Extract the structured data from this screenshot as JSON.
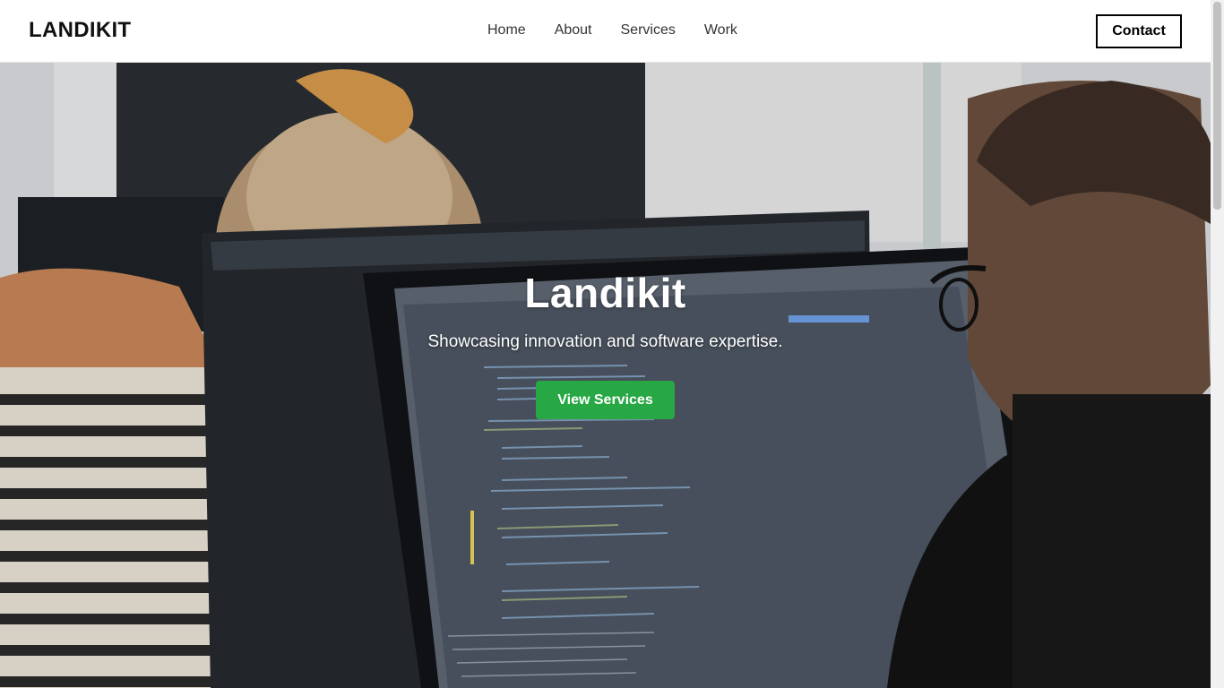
{
  "header": {
    "logo": "LANDIKIT",
    "nav": [
      "Home",
      "About",
      "Services",
      "Work"
    ],
    "contact_label": "Contact"
  },
  "hero": {
    "title": "Landikit",
    "subtitle": "Showcasing innovation and software expertise.",
    "cta_label": "View Services",
    "image_icon": "office-photo-icon"
  },
  "colors": {
    "accent_green": "#28a745",
    "text_dark": "#111111"
  }
}
